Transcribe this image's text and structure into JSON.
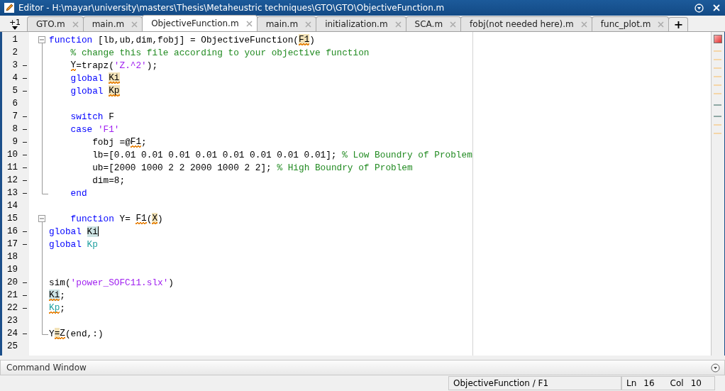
{
  "window": {
    "title": "Editor - H:\\mayar\\university\\masters\\Thesis\\Metaheustric techniques\\GTO\\GTO\\ObjectiveFunction.m"
  },
  "tab_overflow": {
    "label": "+1"
  },
  "tabs": [
    {
      "label": "GTO.m",
      "selected": false
    },
    {
      "label": "main.m",
      "selected": false
    },
    {
      "label": "ObjectiveFunction.m",
      "selected": true
    },
    {
      "label": "main.m",
      "selected": false
    },
    {
      "label": "initialization.m",
      "selected": false
    },
    {
      "label": "SCA.m",
      "selected": false
    },
    {
      "label": "fobj(not needed here).m",
      "selected": false
    },
    {
      "label": "func_plot.m",
      "selected": false
    }
  ],
  "new_tab": {
    "label": "+"
  },
  "code_lines": [
    {
      "number": "1",
      "executable": false,
      "fold_start": true,
      "tokens": [
        {
          "kind": "keyword",
          "text": "function"
        },
        {
          "kind": "plain",
          "text": " [lb,ub,dim,fobj] = ObjectiveFunction("
        },
        {
          "kind": "plain",
          "text": "F1",
          "highlighted": true,
          "warning": true
        },
        {
          "kind": "plain",
          "text": ")"
        }
      ]
    },
    {
      "number": "2",
      "executable": false,
      "tokens": [
        {
          "kind": "comment",
          "text": "    % change this file according to your objective function"
        }
      ]
    },
    {
      "number": "3",
      "executable": true,
      "tokens": [
        {
          "kind": "plain",
          "text": "    Y",
          "warning": true
        },
        {
          "kind": "plain",
          "text": "=trapz("
        },
        {
          "kind": "string",
          "text": "'Z.^2'"
        },
        {
          "kind": "plain",
          "text": ");"
        }
      ]
    },
    {
      "number": "4",
      "executable": true,
      "tokens": [
        {
          "kind": "keyword",
          "text": "    global"
        },
        {
          "kind": "plain",
          "text": " Ki",
          "highlighted": true,
          "warning": true
        }
      ]
    },
    {
      "number": "5",
      "executable": true,
      "tokens": [
        {
          "kind": "keyword",
          "text": "    global"
        },
        {
          "kind": "plain",
          "text": " Kp",
          "highlighted": true,
          "warning": true
        }
      ]
    },
    {
      "number": "6",
      "executable": false
    },
    {
      "number": "7",
      "executable": true,
      "tokens": [
        {
          "kind": "keyword",
          "text": "    switch"
        },
        {
          "kind": "plain",
          "text": " F"
        }
      ]
    },
    {
      "number": "8",
      "executable": true,
      "tokens": [
        {
          "kind": "keyword",
          "text": "    case"
        },
        {
          "kind": "string",
          "text": " 'F1'"
        }
      ]
    },
    {
      "number": "9",
      "executable": true,
      "tokens": [
        {
          "kind": "plain",
          "text": "        fobj =@"
        },
        {
          "kind": "plain",
          "text": "F1",
          "warning": true
        },
        {
          "kind": "plain",
          "text": ";"
        }
      ]
    },
    {
      "number": "10",
      "executable": true,
      "tokens": [
        {
          "kind": "plain",
          "text": "        lb=[0.01 0.01 0.01 0.01 0.01 0.01 0.01 0.01];"
        },
        {
          "kind": "comment",
          "text": " % Low Boundry of Problem"
        }
      ]
    },
    {
      "number": "11",
      "executable": true,
      "tokens": [
        {
          "kind": "plain",
          "text": "        ub=[2000 1000 2 2 2000 1000 2 2];"
        },
        {
          "kind": "comment",
          "text": " % High Boundry of Problem"
        }
      ]
    },
    {
      "number": "12",
      "executable": true,
      "tokens": [
        {
          "kind": "plain",
          "text": "        dim=8;"
        }
      ]
    },
    {
      "number": "13",
      "executable": true,
      "fold_end": true,
      "tokens": [
        {
          "kind": "keyword",
          "text": "    end"
        }
      ]
    },
    {
      "number": "14",
      "executable": false
    },
    {
      "number": "15",
      "executable": false,
      "fold_start": true,
      "tokens": [
        {
          "kind": "keyword",
          "text": "    function"
        },
        {
          "kind": "plain",
          "text": " Y= "
        },
        {
          "kind": "plain",
          "text": "F1",
          "warning": true
        },
        {
          "kind": "plain",
          "text": "("
        },
        {
          "kind": "plain",
          "text": "X",
          "highlighted": true,
          "warning": true
        },
        {
          "kind": "plain",
          "text": ")"
        }
      ]
    },
    {
      "number": "16",
      "executable": true,
      "tokens": [
        {
          "kind": "keyword",
          "text": "global"
        },
        {
          "kind": "plain",
          "text": " Ki",
          "occurrence": true
        }
      ]
    },
    {
      "number": "17",
      "executable": true,
      "tokens": [
        {
          "kind": "keyword",
          "text": "global"
        },
        {
          "kind": "global",
          "text": " Kp"
        }
      ]
    },
    {
      "number": "18",
      "executable": false
    },
    {
      "number": "19",
      "executable": false
    },
    {
      "number": "20",
      "executable": true,
      "tokens": [
        {
          "kind": "plain",
          "text": "sim("
        },
        {
          "kind": "string",
          "text": "'power_SOFC11.slx'"
        },
        {
          "kind": "plain",
          "text": ")"
        }
      ]
    },
    {
      "number": "21",
      "executable": true,
      "tokens": [
        {
          "kind": "plain",
          "text": "Ki",
          "occurrence": true,
          "warning": true
        },
        {
          "kind": "plain",
          "text": ";"
        }
      ]
    },
    {
      "number": "22",
      "executable": true,
      "tokens": [
        {
          "kind": "global",
          "text": "Kp",
          "warning": true
        },
        {
          "kind": "plain",
          "text": ";"
        }
      ]
    },
    {
      "number": "23",
      "executable": false
    },
    {
      "number": "24",
      "executable": true,
      "fold_end": true,
      "tokens": [
        {
          "kind": "plain",
          "text": "Y"
        },
        {
          "kind": "plain",
          "text": "=",
          "highlighted": true,
          "warning": true
        },
        {
          "kind": "plain",
          "text": "Z",
          "warning": true
        },
        {
          "kind": "plain",
          "text": "(end,:)"
        }
      ]
    },
    {
      "number": "25",
      "executable": false
    }
  ],
  "command_window": {
    "title": "Command Window"
  },
  "status_bar": {
    "function": "ObjectiveFunction / F1",
    "ln_label": "Ln",
    "ln": "16",
    "col_label": "Col",
    "col": "10"
  }
}
